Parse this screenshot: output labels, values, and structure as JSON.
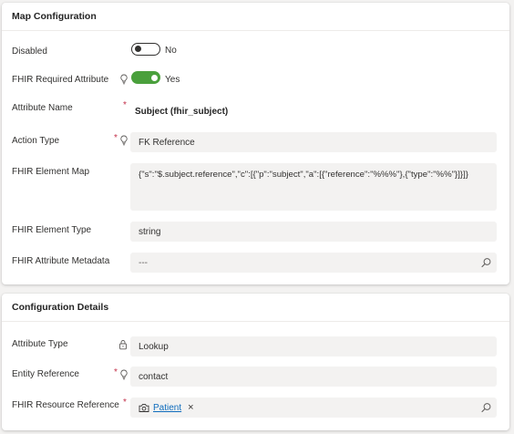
{
  "map_configuration": {
    "title": "Map Configuration",
    "fields": {
      "disabled": {
        "label": "Disabled",
        "value": "No",
        "on": false
      },
      "fhir_required": {
        "label": "FHIR Required Attribute",
        "value": "Yes",
        "on": true
      },
      "attribute_name": {
        "label": "Attribute Name",
        "required_mark": "*",
        "value": "Subject (fhir_subject)"
      },
      "action_type": {
        "label": "Action Type",
        "required_mark": "*",
        "value": "FK Reference"
      },
      "element_map": {
        "label": "FHIR Element Map",
        "value": "{\"s\":\"$.subject.reference\",\"c\":[{\"p\":\"subject\",\"a\":[{\"reference\":\"%%%\"},{\"type\":\"%%\"}]}]}"
      },
      "element_type": {
        "label": "FHIR Element Type",
        "value": "string"
      },
      "attribute_metadata": {
        "label": "FHIR Attribute Metadata",
        "value": "---"
      }
    }
  },
  "configuration_details": {
    "title": "Configuration Details",
    "fields": {
      "attribute_type": {
        "label": "Attribute Type",
        "value": "Lookup"
      },
      "entity_reference": {
        "label": "Entity Reference",
        "required_mark": "*",
        "value": "contact"
      },
      "resource_reference": {
        "label": "FHIR Resource Reference",
        "required_mark": "*",
        "tag": "Patient",
        "remove": "×"
      }
    }
  },
  "colors": {
    "accent": "#4aa03c",
    "link": "#0f6cbd",
    "required": "#c4314b"
  }
}
